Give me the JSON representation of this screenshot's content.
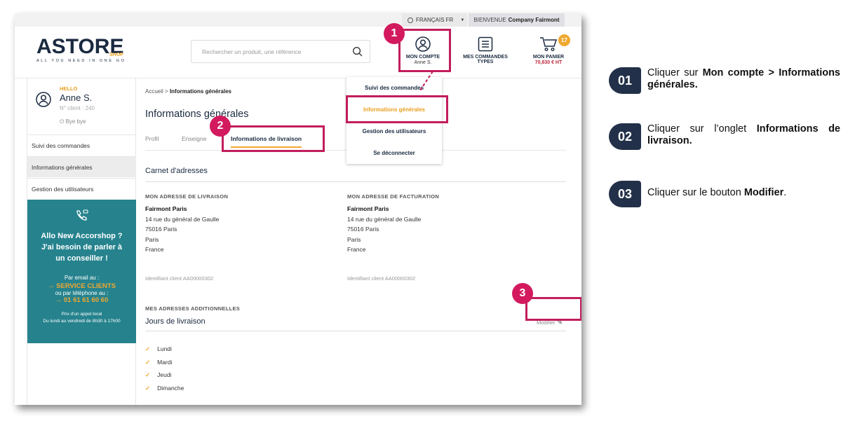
{
  "topbar": {
    "language": "FRANÇAIS FR",
    "welcome_prefix": "BIENVENUE",
    "welcome_company": "Company Fairmont"
  },
  "logo": {
    "name": "ASTORE",
    "shop": "SHOP",
    "tagline": "ALL YOU NEED IN ONE GO"
  },
  "search": {
    "placeholder": "Rechercher un produit, une référence"
  },
  "header_nav": {
    "account_label": "MON COMPTE",
    "account_user": "Anne S.",
    "orders_label_1": "MES COMMANDES",
    "orders_label_2": "TYPES",
    "cart_label": "MON PANIER",
    "cart_total": "70,830 € HT",
    "cart_count": "17"
  },
  "dropdown": {
    "items": [
      "Suivi des commandes",
      "Informations générales",
      "Gestion des utilisateurs",
      "Se déconnecter"
    ]
  },
  "sidebar": {
    "hello": "HELLO",
    "name": "Anne S.",
    "client": "N° client : 240",
    "bye": "Bye bye",
    "items": [
      "Suivi des commandes",
      "Informations générales",
      "Gestion des utilisateurs"
    ],
    "promo": {
      "line1": "Allo New Accorshop ?",
      "line2": "J'ai besoin de parler à",
      "line3": "un conseiller !",
      "email_intro": "Par email au :",
      "service": "SERVICE CLIENTS",
      "phone_intro": "ou par téléphone au :",
      "phone": "01 61 61 60 60",
      "price_note": "Prix d'un appel local",
      "hours": "Du lundi au vendredi de 8h30 à 17h00"
    }
  },
  "breadcrumb": {
    "home": "Accueil",
    "sep": ">",
    "current": "Informations générales"
  },
  "page_title": "Informations générales",
  "tabs": [
    "Profil",
    "Enseigne",
    "Informations de livraison"
  ],
  "carnet": {
    "title": "Carnet d'adresses",
    "delivery": {
      "label": "MON ADRESSE DE LIVRAISON",
      "name": "Fairmont Paris",
      "street": "14 rue du général de Gaulle",
      "city": "75016 Paris",
      "town": "Paris",
      "country": "France",
      "id": "Identifiant client AA00000302"
    },
    "billing": {
      "label": "MON ADRESSE DE FACTURATION",
      "name": "Fairmont Paris",
      "street": "14 rue du général de Gaulle",
      "city": "75016 Paris",
      "town": "Paris",
      "country": "France",
      "id": "Identifiant client AA00000302"
    }
  },
  "additional": {
    "label": "MES ADRESSES ADDITIONNELLES",
    "title": "Jours de livraison",
    "modify": "Modifier",
    "days": [
      "Lundi",
      "Mardi",
      "Jeudi",
      "Dimanche"
    ]
  },
  "callouts": [
    "1",
    "2",
    "3"
  ],
  "steps": [
    {
      "num": "01",
      "text_pre": "Cliquer sur ",
      "bold": "Mon compte > Informations générales.",
      "text_post": ""
    },
    {
      "num": "02",
      "text_pre": "Cliquer sur l’onglet ",
      "bold": "Informations de livraison.",
      "text_post": ""
    },
    {
      "num": "03",
      "text_pre": "Cliquer sur le bouton ",
      "bold": "Modifier",
      "text_post": "."
    }
  ],
  "colors": {
    "accent": "#f0a830",
    "navy": "#1a2a40",
    "teal": "#26838e",
    "callout": "#d31a5e",
    "step_bg": "#223049"
  }
}
